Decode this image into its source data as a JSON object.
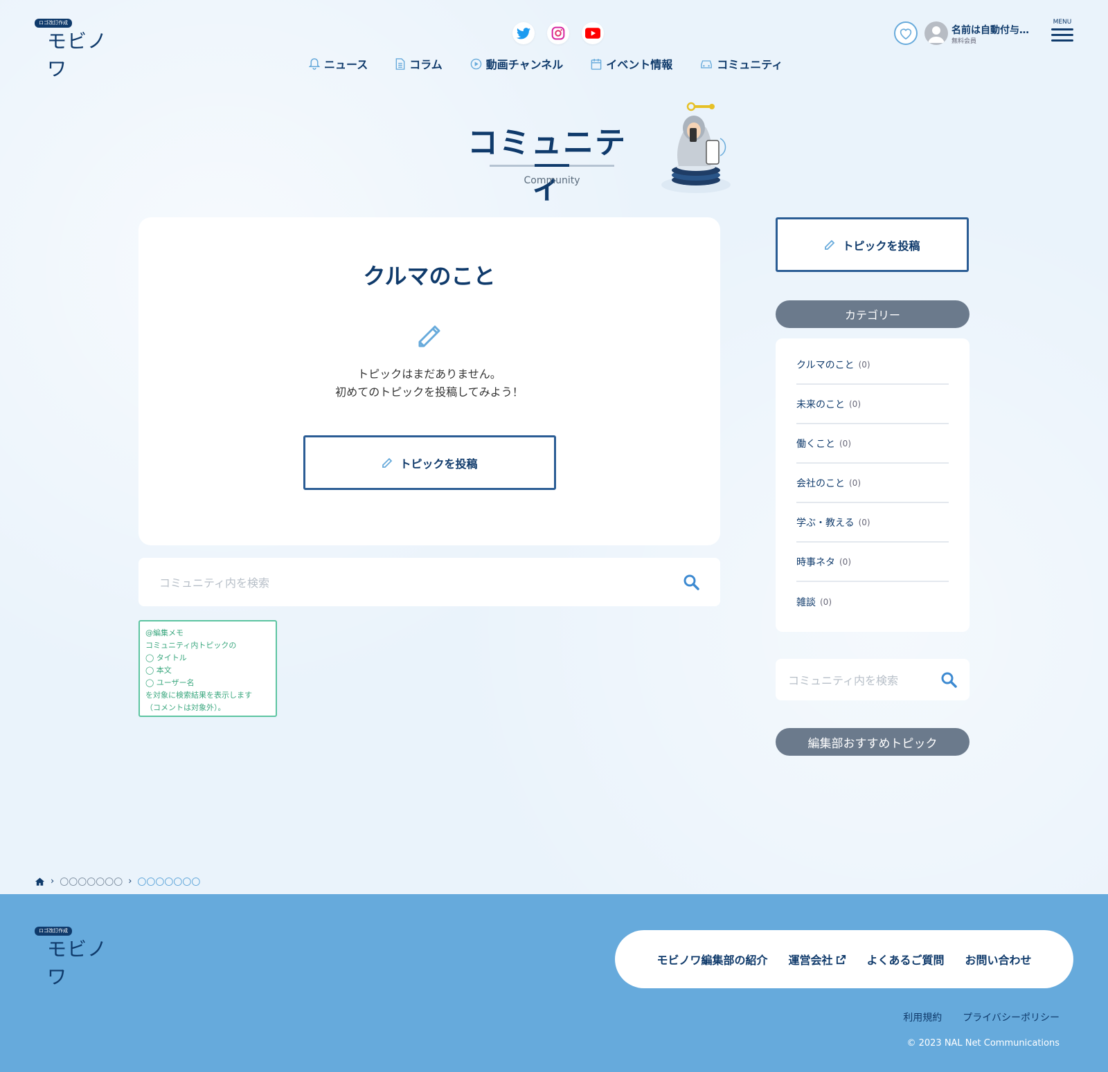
{
  "brand": {
    "tag": "ロゴ改訂作成",
    "name": "モビノワ"
  },
  "header": {
    "user_name": "名前は自動付与…",
    "user_type": "無料会員",
    "menu_label": "MENU"
  },
  "nav": [
    {
      "label": "ニュース",
      "icon": "bell-icon"
    },
    {
      "label": "コラム",
      "icon": "document-icon"
    },
    {
      "label": "動画チャンネル",
      "icon": "play-icon"
    },
    {
      "label": "イベント情報",
      "icon": "calendar-icon"
    },
    {
      "label": "コミュニティ",
      "icon": "car-icon"
    }
  ],
  "page": {
    "title": "コミュニティ",
    "subtitle": "Community"
  },
  "main": {
    "category_title": "クルマのこと",
    "empty_line1": "トピックはまだありません。",
    "empty_line2": "初めてのトピックを投稿してみよう！",
    "post_button": "トピックを投稿",
    "search_placeholder": "コミュニティ内を検索"
  },
  "memo": {
    "lines": [
      "@編集メモ",
      "コミュニティ内トピックの",
      "◯ タイトル",
      "◯ 本文",
      "◯ ユーザー名",
      "を対象に検索結果を表示します",
      "（コメントは対象外）。"
    ]
  },
  "sidebar": {
    "post_button": "トピックを投稿",
    "category_heading": "カテゴリー",
    "categories": [
      {
        "label": "クルマのこと",
        "count": "(0)"
      },
      {
        "label": "未来のこと",
        "count": "(0)"
      },
      {
        "label": "働くこと",
        "count": "(0)"
      },
      {
        "label": "会社のこと",
        "count": "(0)"
      },
      {
        "label": "学ぶ・教える",
        "count": "(0)"
      },
      {
        "label": "時事ネタ",
        "count": "(0)"
      },
      {
        "label": "雑談",
        "count": "(0)"
      }
    ],
    "search_placeholder": "コミュニティ内を検索",
    "recommend_heading": "編集部おすすめトピック"
  },
  "breadcrumb": {
    "item1": "〇〇〇〇〇〇〇",
    "item2": "〇〇〇〇〇〇〇"
  },
  "footer": {
    "nav": [
      "モビノワ編集部の紹介",
      "運営会社",
      "よくあるご質問",
      "お問い合わせ"
    ],
    "terms": "利用規約",
    "privacy": "プライバシーポリシー",
    "copyright": "© 2023 NAL Net Communications"
  },
  "colors": {
    "brand": "#0f3a6b",
    "accent": "#67aadb",
    "footer_bg": "#66aadc",
    "memo": "#5cc4a0"
  }
}
